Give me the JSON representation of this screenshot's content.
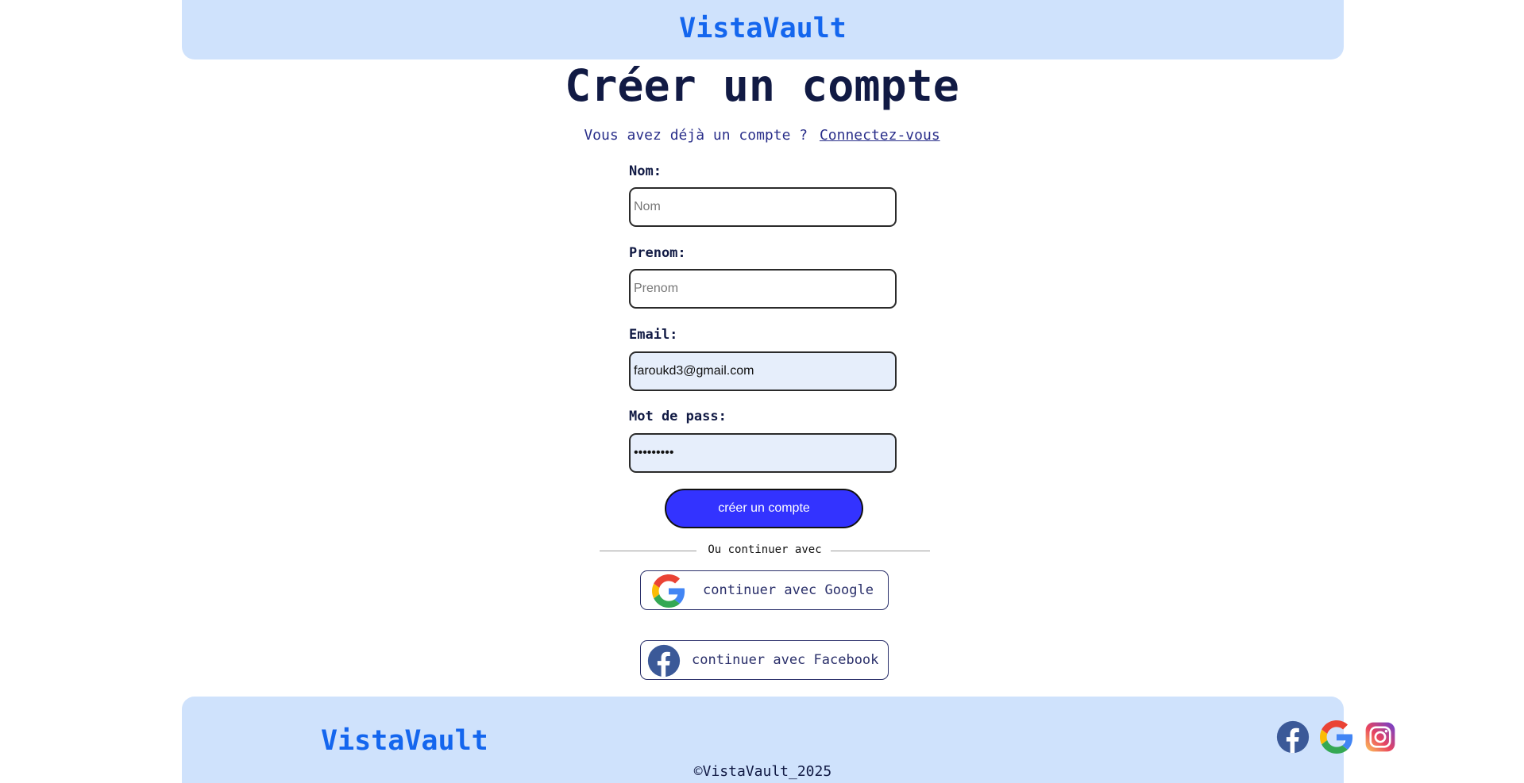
{
  "header": {
    "brand": "VistaVault"
  },
  "main": {
    "title": "Créer un compte",
    "signin_prompt": "Vous avez déjà un compte ?",
    "signin_link": "Connectez-vous",
    "fields": {
      "nom": {
        "label": "Nom:",
        "placeholder": "Nom",
        "value": ""
      },
      "prenom": {
        "label": "Prenom:",
        "placeholder": "Prenom",
        "value": ""
      },
      "email": {
        "label": "Email:",
        "placeholder": "",
        "value": "faroukd3@gmail.com"
      },
      "password": {
        "label": "Mot de pass:",
        "placeholder": "",
        "value": "*********"
      }
    },
    "submit_label": "créer un compte",
    "divider_text": "Ou continuer avec",
    "google_button": "continuer avec Google",
    "facebook_button": "continuer avec Facebook"
  },
  "footer": {
    "brand": "VistaVault",
    "copyright": "©VistaVault_2025",
    "social_icons": [
      "facebook-icon",
      "google-icon",
      "instagram-icon"
    ]
  },
  "colors": {
    "brand": "#1466ee",
    "header_bg": "#cfe2fc",
    "submit_bg": "#3333ff",
    "title": "#111a44"
  }
}
